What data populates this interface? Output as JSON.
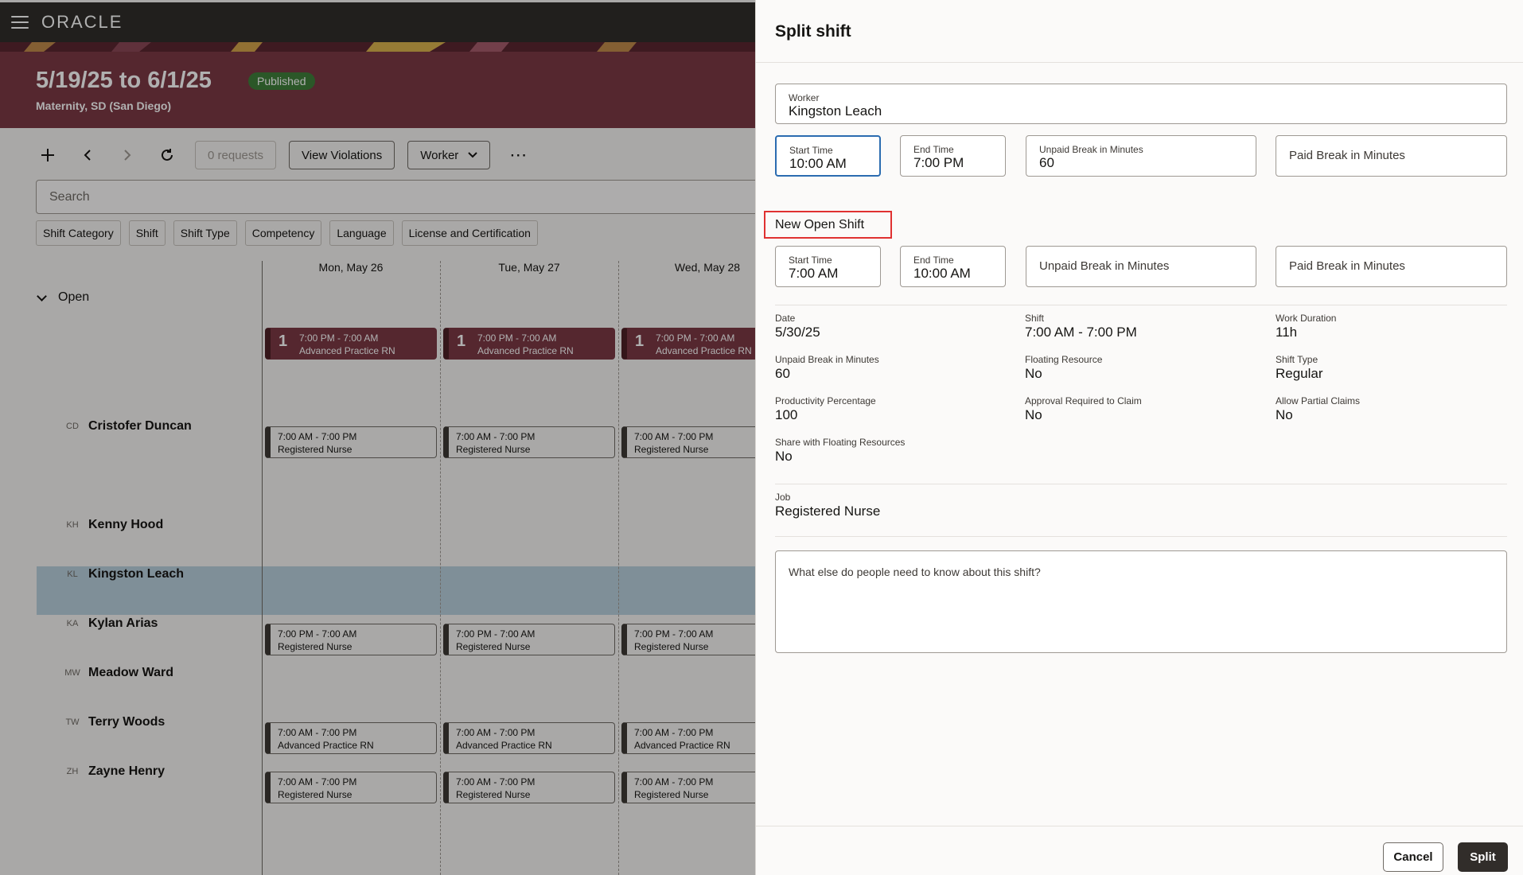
{
  "app": {
    "logo": "ORACLE",
    "banner": {
      "title": "5/19/25 to 6/1/25",
      "badge": "Published",
      "subtitle": "Maternity, SD (San Diego)"
    },
    "toolbar": {
      "requests": "0 requests",
      "violations": "View Violations",
      "view_select": "Worker"
    },
    "search_placeholder": "Search",
    "filters": [
      "Shift Category",
      "Shift",
      "Shift Type",
      "Competency",
      "Language",
      "License and Certification"
    ],
    "days": [
      "Mon, May 26",
      "Tue, May 27",
      "Wed, May 28"
    ],
    "open_label": "Open",
    "open_shift": {
      "count": "1",
      "time": "7:00 PM - 7:00 AM",
      "role": "Advanced Practice RN"
    },
    "workers": [
      {
        "initials": "CD",
        "name": "Cristofer Duncan",
        "shift_time": "7:00 AM - 7:00 PM",
        "shift_role": "Registered Nurse"
      },
      {
        "initials": "KH",
        "name": "Kenny Hood"
      },
      {
        "initials": "KL",
        "name": "Kingston Leach"
      },
      {
        "initials": "KA",
        "name": "Kylan Arias",
        "shift_time": "7:00 PM - 7:00 AM",
        "shift_role": "Registered Nurse"
      },
      {
        "initials": "MW",
        "name": "Meadow Ward"
      },
      {
        "initials": "TW",
        "name": "Terry Woods",
        "shift_time": "7:00 AM - 7:00 PM",
        "shift_role": "Advanced Practice RN"
      },
      {
        "initials": "ZH",
        "name": "Zayne Henry",
        "shift_time": "7:00 AM - 7:00 PM",
        "shift_role": "Registered Nurse"
      }
    ]
  },
  "drawer": {
    "title": "Split shift",
    "worker": {
      "label": "Worker",
      "value": "Kingston Leach"
    },
    "original": {
      "start": {
        "label": "Start Time",
        "value": "10:00 AM"
      },
      "end": {
        "label": "End Time",
        "value": "7:00 PM"
      },
      "unpaid": {
        "label": "Unpaid Break in Minutes",
        "value": "60"
      },
      "paid": {
        "label": "Paid Break in Minutes"
      }
    },
    "new_section": "New Open Shift",
    "new_shift": {
      "start": {
        "label": "Start Time",
        "value": "7:00 AM"
      },
      "end": {
        "label": "End Time",
        "value": "10:00 AM"
      },
      "unpaid": {
        "label": "Unpaid Break in Minutes"
      },
      "paid": {
        "label": "Paid Break in Minutes"
      }
    },
    "details": {
      "date": {
        "label": "Date",
        "value": "5/30/25"
      },
      "shift": {
        "label": "Shift",
        "value": "7:00 AM - 7:00 PM"
      },
      "duration": {
        "label": "Work Duration",
        "value": "11h"
      },
      "unpaid": {
        "label": "Unpaid Break in Minutes",
        "value": "60"
      },
      "floating": {
        "label": "Floating Resource",
        "value": "No"
      },
      "shift_type": {
        "label": "Shift Type",
        "value": "Regular"
      },
      "productivity": {
        "label": "Productivity Percentage",
        "value": "100"
      },
      "approval": {
        "label": "Approval Required to Claim",
        "value": "No"
      },
      "partial": {
        "label": "Allow Partial Claims",
        "value": "No"
      },
      "share": {
        "label": "Share with Floating Resources",
        "value": "No"
      },
      "job": {
        "label": "Job",
        "value": "Registered Nurse"
      }
    },
    "notes_placeholder": "What else do people need to know about this shift?",
    "cancel": "Cancel",
    "split": "Split"
  }
}
